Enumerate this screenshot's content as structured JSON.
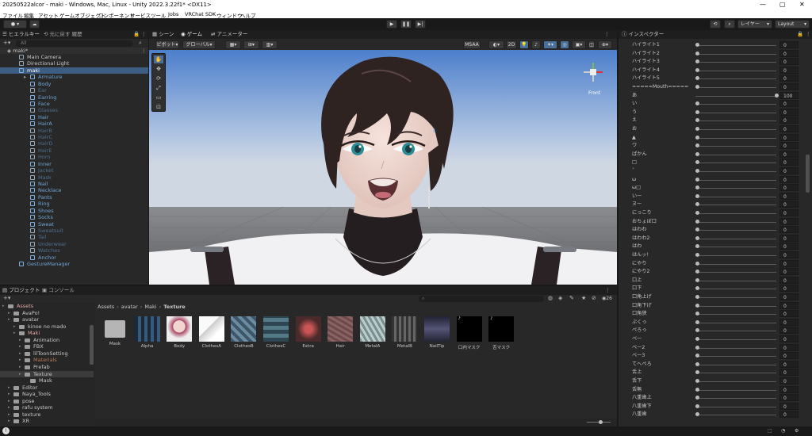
{
  "window": {
    "title": "20250522alcor - maki - Windows, Mac, Linux - Unity 2022.3.22f1* <DX11>"
  },
  "menu": [
    "ファイル",
    "編集",
    "アセット",
    "ゲームオブジェクト",
    "コンポーネント",
    "サービス",
    "ツール",
    "Jobs",
    "VRChat SDK",
    "ウィンドウ",
    "ヘルプ"
  ],
  "toolbar": {
    "layers_label": "レイヤー",
    "layout_label": "Layout"
  },
  "hierarchy": {
    "tabs": [
      "ヒエラルキー",
      "元に戻す 履歴"
    ],
    "search_placeholder": "All",
    "scene": "maki*",
    "items": [
      {
        "label": "Main Camera",
        "indent": 1,
        "style": "normal"
      },
      {
        "label": "Directional Light",
        "indent": 1,
        "style": "normal"
      },
      {
        "label": "maki",
        "indent": 1,
        "style": "selected"
      },
      {
        "label": "Armature",
        "indent": 2,
        "style": "hl"
      },
      {
        "label": "Body",
        "indent": 2,
        "style": "hl"
      },
      {
        "label": "Ear",
        "indent": 2,
        "style": "dim"
      },
      {
        "label": "Earring",
        "indent": 2,
        "style": "hl"
      },
      {
        "label": "Face",
        "indent": 2,
        "style": "hl"
      },
      {
        "label": "Glasses",
        "indent": 2,
        "style": "dim"
      },
      {
        "label": "Hair",
        "indent": 2,
        "style": "hl"
      },
      {
        "label": "HairA",
        "indent": 2,
        "style": "hl"
      },
      {
        "label": "HairB",
        "indent": 2,
        "style": "dim"
      },
      {
        "label": "HairC",
        "indent": 2,
        "style": "dim"
      },
      {
        "label": "HairD",
        "indent": 2,
        "style": "dim"
      },
      {
        "label": "HairE",
        "indent": 2,
        "style": "dim"
      },
      {
        "label": "Horn",
        "indent": 2,
        "style": "dim"
      },
      {
        "label": "Inner",
        "indent": 2,
        "style": "hl"
      },
      {
        "label": "Jacket",
        "indent": 2,
        "style": "dim"
      },
      {
        "label": "Mask",
        "indent": 2,
        "style": "dim"
      },
      {
        "label": "Nail",
        "indent": 2,
        "style": "hl"
      },
      {
        "label": "Necklace",
        "indent": 2,
        "style": "hl"
      },
      {
        "label": "Pants",
        "indent": 2,
        "style": "hl"
      },
      {
        "label": "Ring",
        "indent": 2,
        "style": "hl"
      },
      {
        "label": "Shoes",
        "indent": 2,
        "style": "hl"
      },
      {
        "label": "Socks",
        "indent": 2,
        "style": "hl"
      },
      {
        "label": "Sweat",
        "indent": 2,
        "style": "hl"
      },
      {
        "label": "Sweatsuit",
        "indent": 2,
        "style": "dim"
      },
      {
        "label": "Tail",
        "indent": 2,
        "style": "dim"
      },
      {
        "label": "Underwear",
        "indent": 2,
        "style": "dim"
      },
      {
        "label": "Watches",
        "indent": 2,
        "style": "dim"
      },
      {
        "label": "Anchor",
        "indent": 2,
        "style": "hl"
      },
      {
        "label": "GestureManager",
        "indent": 1,
        "style": "hl"
      }
    ]
  },
  "scene_view": {
    "tabs": [
      "シーン",
      "ゲーム",
      "アニメーター"
    ],
    "pivot_label": "ピボット",
    "global_label": "グローバル",
    "msaa_label": "MSAA",
    "mode_2d": "2D",
    "gizmo_label": "Front"
  },
  "project": {
    "tabs": [
      "プロジェクト",
      "コンソール"
    ],
    "count": "26",
    "tree": [
      {
        "label": "Assets",
        "indent": 0,
        "style": "header"
      },
      {
        "label": "AvaPo!",
        "indent": 1,
        "style": "normal"
      },
      {
        "label": "avatar",
        "indent": 1,
        "style": "normal"
      },
      {
        "label": "kinoe no mado",
        "indent": 2,
        "style": "normal"
      },
      {
        "label": "Maki",
        "indent": 2,
        "style": "header"
      },
      {
        "label": "Animation",
        "indent": 3,
        "style": "normal"
      },
      {
        "label": "FBX",
        "indent": 3,
        "style": "normal"
      },
      {
        "label": "lilToonSetting",
        "indent": 3,
        "style": "normal"
      },
      {
        "label": "Materials",
        "indent": 3,
        "style": "brown"
      },
      {
        "label": "Prefab",
        "indent": 3,
        "style": "normal"
      },
      {
        "label": "Texture",
        "indent": 3,
        "style": "selected"
      },
      {
        "label": "Mask",
        "indent": 4,
        "style": "normal"
      },
      {
        "label": "Editor",
        "indent": 1,
        "style": "normal"
      },
      {
        "label": "Naya_Tools",
        "indent": 1,
        "style": "normal"
      },
      {
        "label": "pose",
        "indent": 1,
        "style": "normal"
      },
      {
        "label": "rafu system",
        "indent": 1,
        "style": "normal"
      },
      {
        "label": "texture",
        "indent": 1,
        "style": "normal"
      },
      {
        "label": "XR",
        "indent": 1,
        "style": "normal"
      }
    ],
    "breadcrumb": [
      "Assets",
      "avatar",
      "Maki",
      "Texture"
    ],
    "assets": [
      "Mask",
      "Alpha",
      "Body",
      "ClothesA",
      "ClothesB",
      "ClothesC",
      "Extra",
      "Hair",
      "MetalA",
      "MetalB",
      "NailTip",
      "口内マスク",
      "舌マスク"
    ]
  },
  "inspector": {
    "tab": "インスペクター",
    "rows": [
      {
        "label": "ハイライト1",
        "value": "0",
        "level": 0
      },
      {
        "label": "ハイライト2",
        "value": "0",
        "level": 0
      },
      {
        "label": "ハイライト3",
        "value": "0",
        "level": 0
      },
      {
        "label": "ハイライト4",
        "value": "0",
        "level": 0
      },
      {
        "label": "ハイライト5",
        "value": "0",
        "level": 0
      },
      {
        "label": "=====Mouth=====",
        "value": "0",
        "level": 0
      },
      {
        "label": "あ",
        "value": "100",
        "level": 1
      },
      {
        "label": "い",
        "value": "0",
        "level": 0
      },
      {
        "label": "う",
        "value": "0",
        "level": 0
      },
      {
        "label": "え",
        "value": "0",
        "level": 0
      },
      {
        "label": "お",
        "value": "0",
        "level": 0
      },
      {
        "label": "▲",
        "value": "0",
        "level": 0
      },
      {
        "label": "ワ",
        "value": "0",
        "level": 0
      },
      {
        "label": "ぱかん",
        "value": "0",
        "level": 0
      },
      {
        "label": "□",
        "value": "0",
        "level": 0
      },
      {
        "label": "ˇ",
        "value": "0",
        "level": 0
      },
      {
        "label": "ω",
        "value": "0",
        "level": 0
      },
      {
        "label": "ω□",
        "value": "0",
        "level": 0
      },
      {
        "label": "いー",
        "value": "0",
        "level": 0
      },
      {
        "label": "ヌー",
        "value": "0",
        "level": 0
      },
      {
        "label": "にっこり",
        "value": "0",
        "level": 0
      },
      {
        "label": "おちょぼ口",
        "value": "0",
        "level": 0
      },
      {
        "label": "はわわ",
        "value": "0",
        "level": 0
      },
      {
        "label": "はわわ2",
        "value": "0",
        "level": 0
      },
      {
        "label": "はわ",
        "value": "0",
        "level": 0
      },
      {
        "label": "はんッ!",
        "value": "0",
        "level": 0
      },
      {
        "label": "にやり",
        "value": "0",
        "level": 0
      },
      {
        "label": "にやり2",
        "value": "0",
        "level": 0
      },
      {
        "label": "口上",
        "value": "0",
        "level": 0
      },
      {
        "label": "口下",
        "value": "0",
        "level": 0
      },
      {
        "label": "口角上げ",
        "value": "0",
        "level": 0
      },
      {
        "label": "口角下げ",
        "value": "0",
        "level": 0
      },
      {
        "label": "口角狭",
        "value": "0",
        "level": 0
      },
      {
        "label": "ぷくっ",
        "value": "0",
        "level": 0
      },
      {
        "label": "ぺろっ",
        "value": "0",
        "level": 0
      },
      {
        "label": "ベー",
        "value": "0",
        "level": 0
      },
      {
        "label": "ベー2",
        "value": "0",
        "level": 0
      },
      {
        "label": "ベー3",
        "value": "0",
        "level": 0
      },
      {
        "label": "てへぺろ",
        "value": "0",
        "level": 0
      },
      {
        "label": "舌上",
        "value": "0",
        "level": 0
      },
      {
        "label": "舌下",
        "value": "0",
        "level": 0
      },
      {
        "label": "舌無",
        "value": "0",
        "level": 0
      },
      {
        "label": "八重歯上",
        "value": "0",
        "level": 0
      },
      {
        "label": "八重歯下",
        "value": "0",
        "level": 0
      },
      {
        "label": "八重歯",
        "value": "0",
        "level": 0
      }
    ]
  },
  "statusbar": {
    "text": "!"
  }
}
